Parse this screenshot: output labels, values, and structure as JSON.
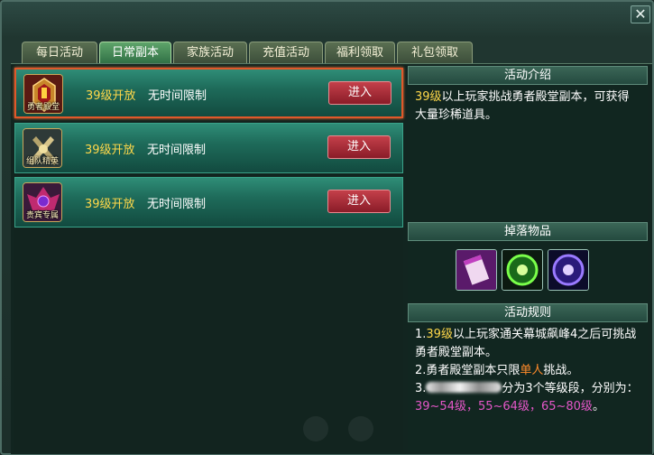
{
  "window": {
    "close_label": "✕"
  },
  "tabs": [
    {
      "label": "每日活动",
      "active": false
    },
    {
      "label": "日常副本",
      "active": true
    },
    {
      "label": "家族活动",
      "active": false
    },
    {
      "label": "充值活动",
      "active": false
    },
    {
      "label": "福利领取",
      "active": false
    },
    {
      "label": "礼包领取",
      "active": false
    }
  ],
  "activities": [
    {
      "icon": "brave-hall-icon",
      "icon_caption": "勇者殿堂",
      "level": "39级开放",
      "time": "无时间限制",
      "button": "进入",
      "selected": true
    },
    {
      "icon": "elite-team-icon",
      "icon_caption": "组队精英",
      "level": "39级开放",
      "time": "无时间限制",
      "button": "进入",
      "selected": false
    },
    {
      "icon": "vip-exclusive-icon",
      "icon_caption": "贵宾专属",
      "level": "39级开放",
      "time": "无时间限制",
      "button": "进入",
      "selected": false
    }
  ],
  "intro": {
    "header": "活动介绍",
    "level": "39级",
    "text": "以上玩家挑战勇者殿堂副本，可获得大量珍稀道具。"
  },
  "drops": {
    "header": "掉落物品",
    "items": [
      "scroll-item-icon",
      "green-orb-icon",
      "purple-orb-icon"
    ]
  },
  "rules": {
    "header": "活动规则",
    "line1_prefix": "1.",
    "line1_level": "39级",
    "line1_text": "以上玩家通关幕城飙峰4之后可挑战勇者殿堂副本。",
    "line2_text": "2.勇者殿堂副本只限",
    "line2_highlight": "单人",
    "line2_suffix": "挑战。",
    "line3_prefix": "3.",
    "line3_text": "分为3个等级段，分别为：",
    "line3_ranges": "39~54级，55~64级，65~80级",
    "line3_end": "。"
  },
  "colors": {
    "accent_yellow": "#ffd84a",
    "accent_orange": "#ff8a2a",
    "accent_pink": "#e457c8",
    "enter_button": "#a82a36",
    "selected_border": "#e0582a"
  }
}
